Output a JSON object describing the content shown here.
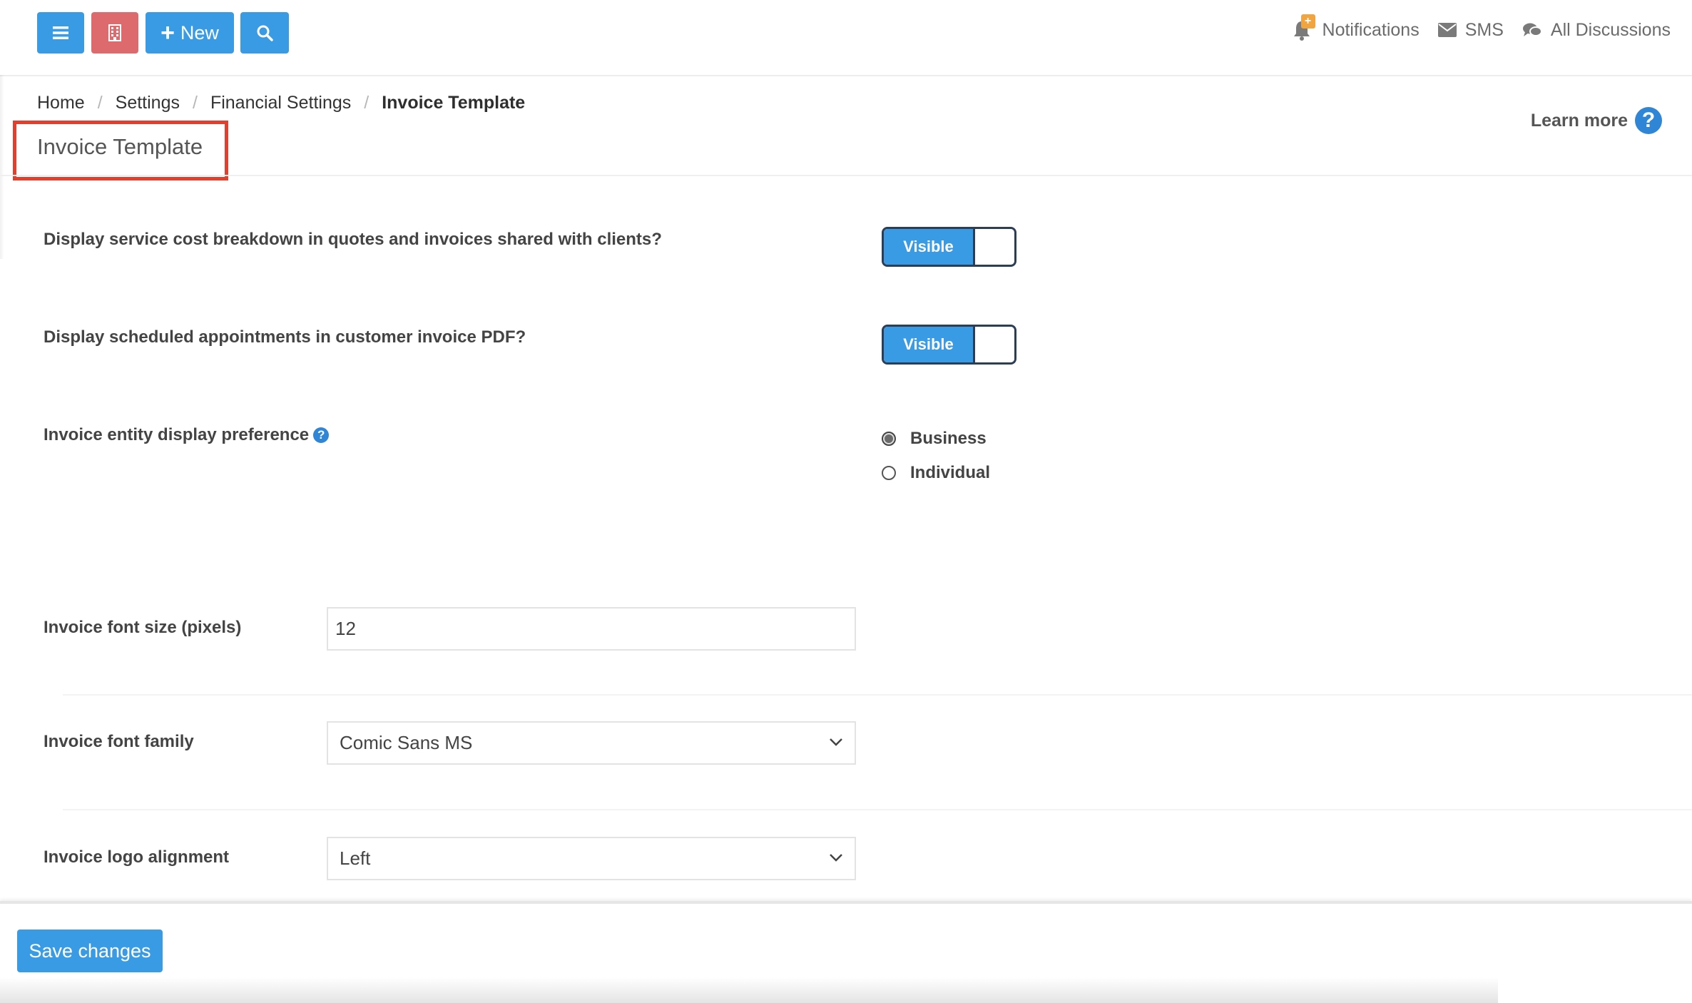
{
  "topbar": {
    "new_label": "New",
    "notifications_label": "Notifications",
    "notifications_badge": "+",
    "sms_label": "SMS",
    "discussions_label": "All Discussions",
    "colors": {
      "primary": "#3a9be5",
      "danger": "#dd6b6e",
      "badge": "#f0a540"
    }
  },
  "breadcrumb": {
    "items": [
      "Home",
      "Settings",
      "Financial Settings"
    ],
    "current": "Invoice Template",
    "separator": "/"
  },
  "header": {
    "title": "Invoice Template",
    "learn_more": "Learn more",
    "highlight_color": "#e53e2c"
  },
  "form": {
    "service_cost_breakdown": {
      "label": "Display service cost breakdown in quotes and invoices shared with clients?",
      "toggle_text": "Visible"
    },
    "scheduled_appointments": {
      "label": "Display scheduled appointments in customer invoice PDF?",
      "toggle_text": "Visible"
    },
    "entity_display": {
      "label": "Invoice entity display preference",
      "options": [
        "Business",
        "Individual"
      ],
      "selected": "Business"
    },
    "font_size": {
      "label": "Invoice font size (pixels)",
      "value": "12"
    },
    "font_family": {
      "label": "Invoice font family",
      "value": "Comic Sans MS"
    },
    "logo_alignment": {
      "label": "Invoice logo alignment",
      "value": "Left"
    }
  },
  "footer": {
    "save_label": "Save changes"
  }
}
